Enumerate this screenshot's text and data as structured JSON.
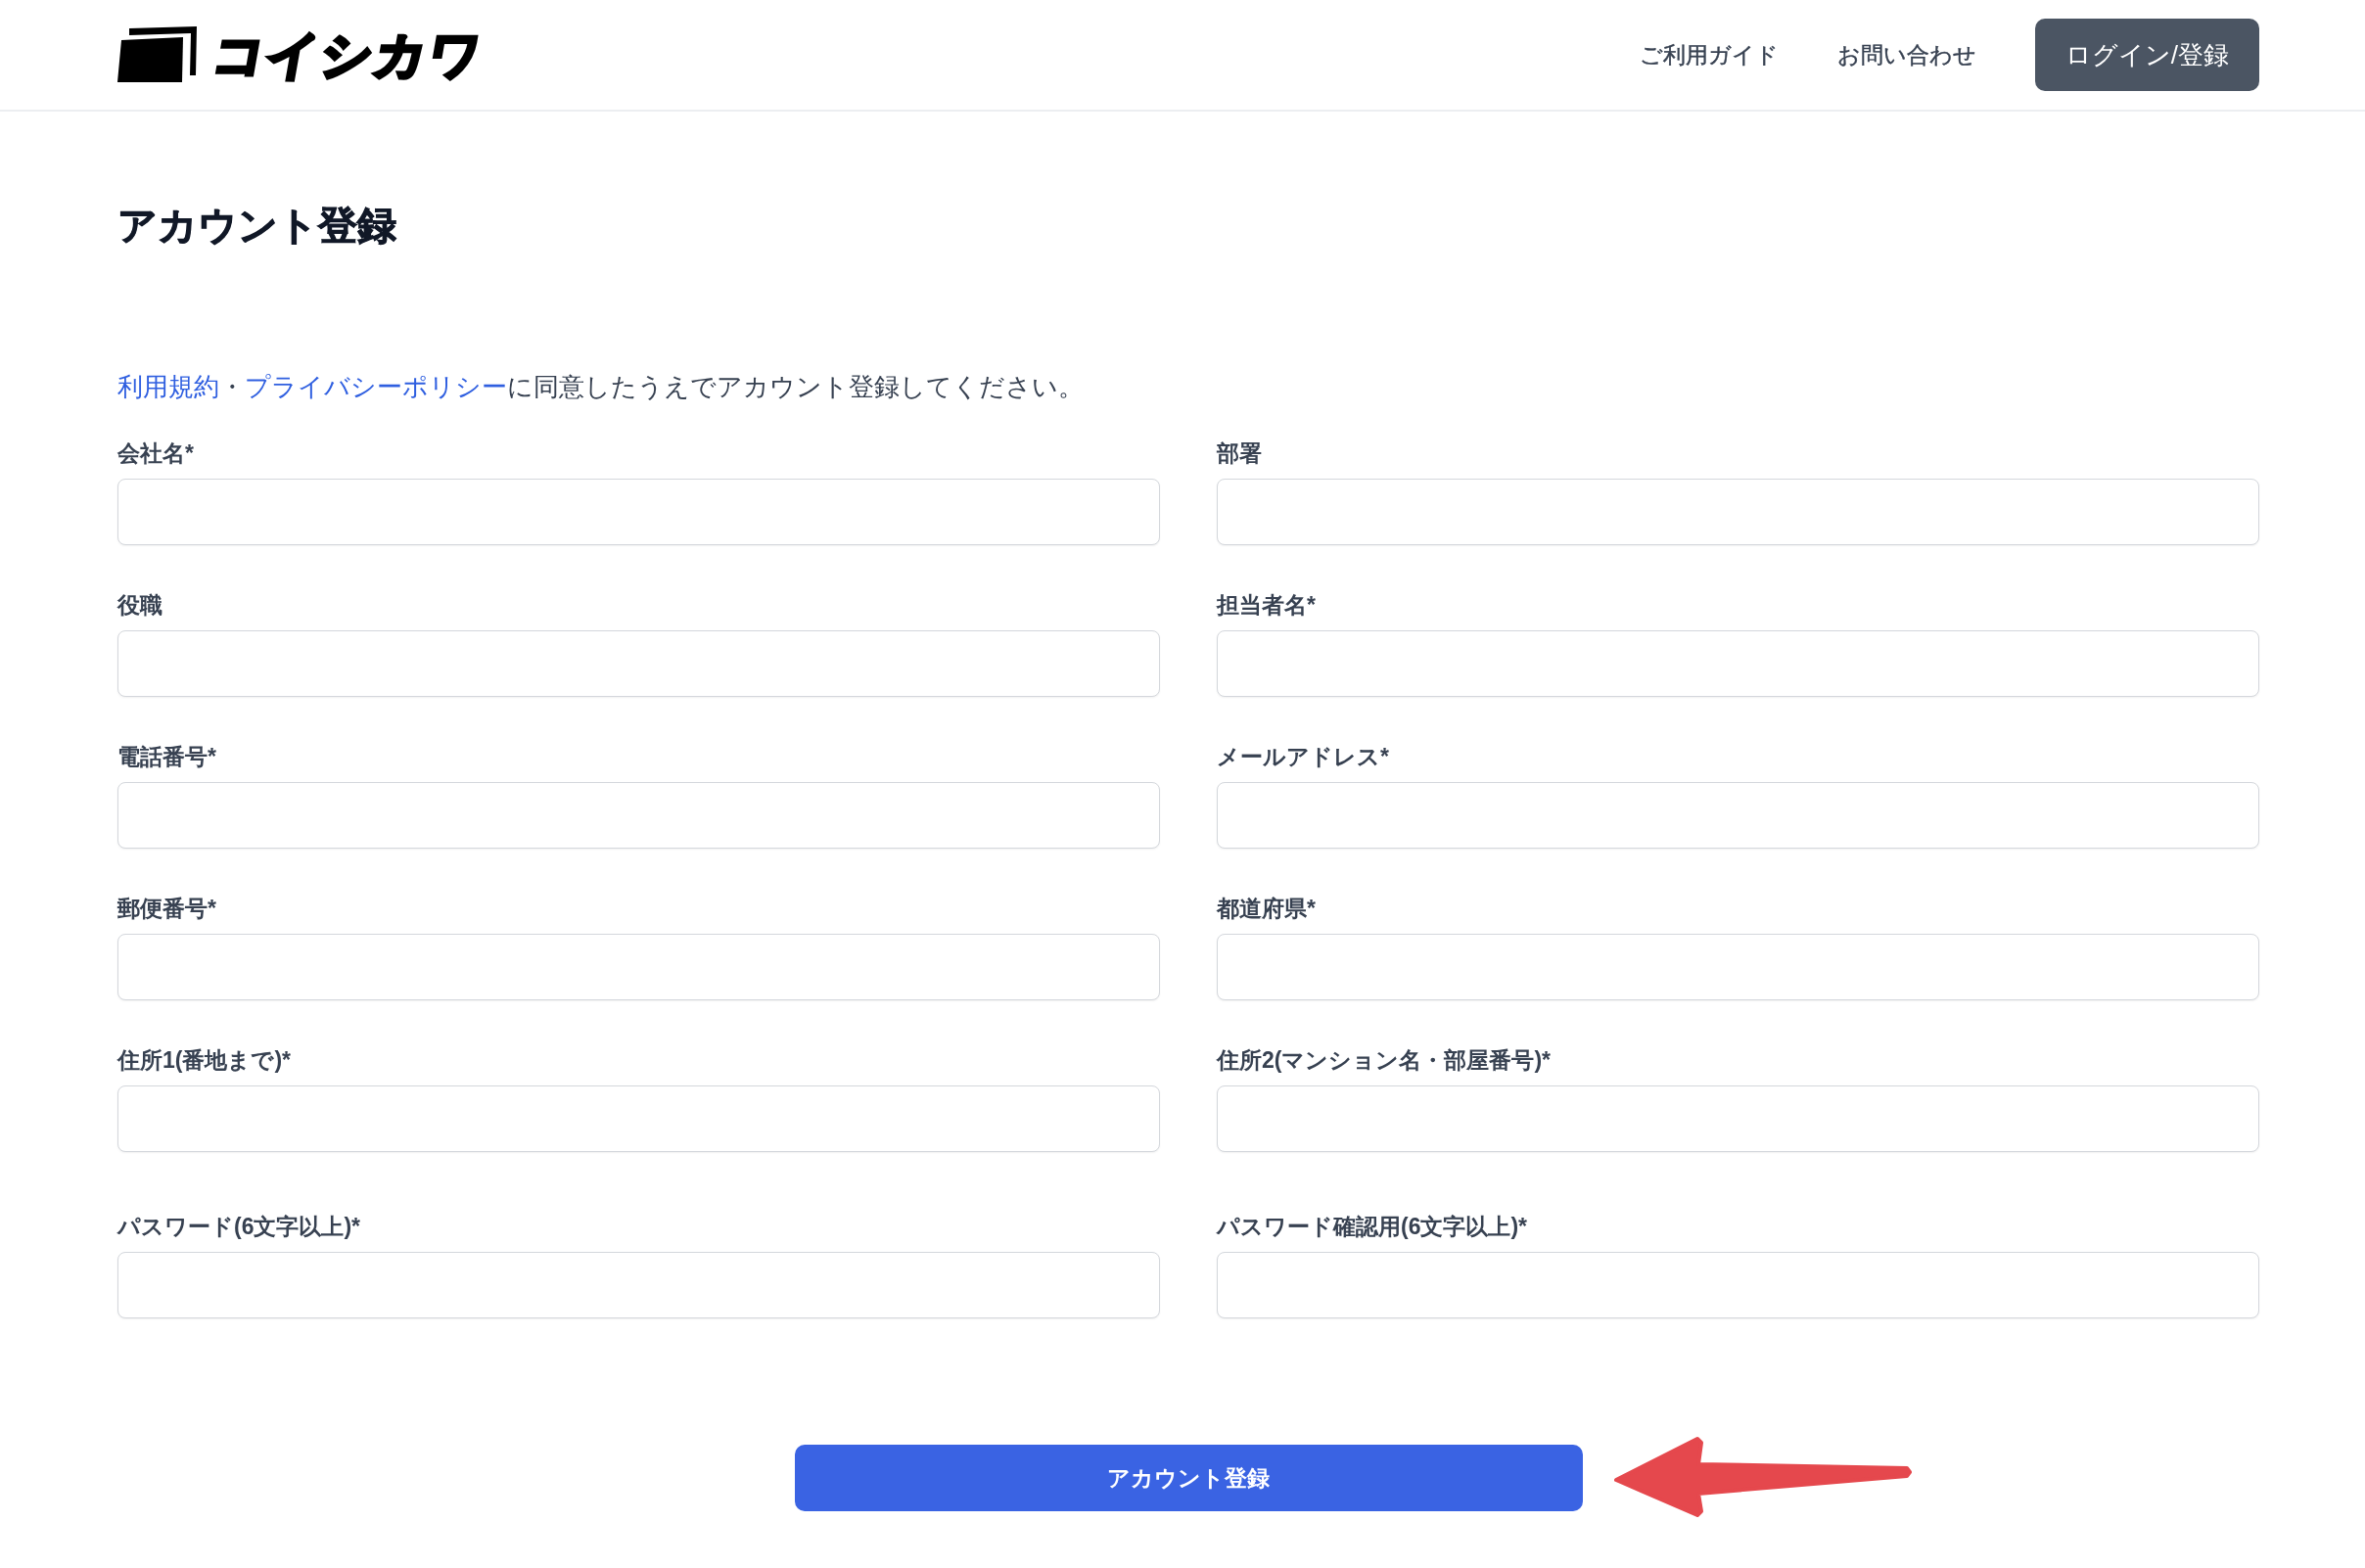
{
  "header": {
    "logo": {
      "text": "コイシカワ"
    },
    "nav": [
      {
        "label": "ご利用ガイド",
        "kind": "link"
      },
      {
        "label": "お問い合わせ",
        "kind": "link"
      },
      {
        "label": "ログイン/登録",
        "kind": "button"
      }
    ]
  },
  "page_title": "アカウント登録",
  "notice": [
    {
      "text": "利用規約",
      "kind": "link"
    },
    {
      "text": "・",
      "kind": "text"
    },
    {
      "text": "プライバシーポリシー",
      "kind": "link"
    },
    {
      "text": "に同意したうえでアカウント登録してください。",
      "kind": "text"
    }
  ],
  "form": {
    "fields": [
      {
        "label": "会社名*"
      },
      {
        "label": "部署"
      },
      {
        "label": "役職"
      },
      {
        "label": "担当者名*"
      },
      {
        "label": "電話番号*"
      },
      {
        "label": "メールアドレス*"
      },
      {
        "label": "郵便番号*"
      },
      {
        "label": "都道府県*"
      },
      {
        "label": "住所1(番地まで)*"
      },
      {
        "label": "住所2(マンション名・部屋番号)*"
      }
    ],
    "password_fields": [
      {
        "label": "パスワード(6文字以上)*"
      },
      {
        "label": "パスワード確認用(6文字以上)*"
      }
    ]
  },
  "submit_button": {
    "label": "アカウント登録"
  }
}
